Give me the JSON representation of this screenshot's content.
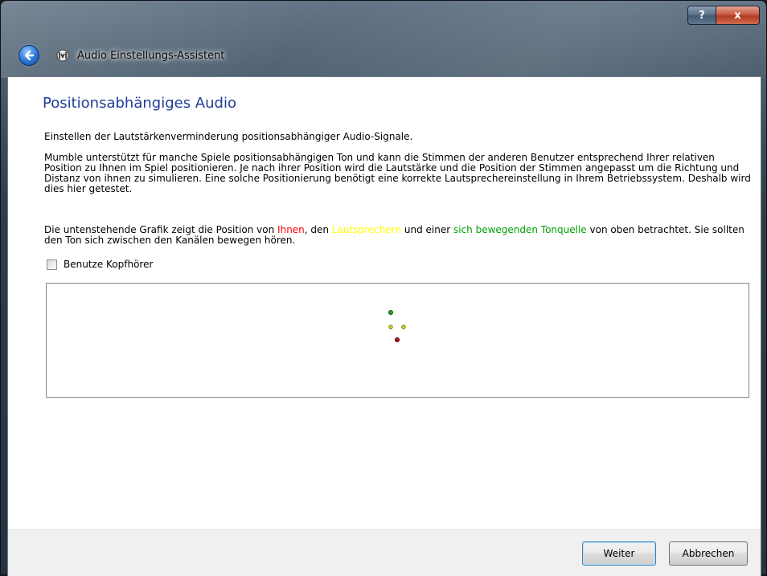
{
  "window": {
    "title": "Audio Einstellungs-Assistent",
    "help_label": "?",
    "close_label": "x"
  },
  "page": {
    "heading": "Positionsabhängiges Audio",
    "subtitle": "Einstellen der Lautstärkenverminderung positionsabhängiger Audio-Signale.",
    "description": "Mumble unterstützt für manche Spiele positionsabhängigen Ton und kann die Stimmen der anderen Benutzer entsprechend Ihrer relativen Position zu Ihnen im Spiel positionieren. Je nach ihrer Position wird die Lautstärke und die Position der Stimmen angepasst um die Richtung und Distanz von ihnen zu simulieren. Eine solche Positionierung benötigt eine korrekte Lautsprechereinstellung in Ihrem Betriebssystem. Deshalb wird dies hier getestet.",
    "graphic_intro_1": "Die untenstehende Grafik zeigt die Position von ",
    "you_word": "Ihnen",
    "sep_1": ", den ",
    "speakers_word": "Lautsprechern",
    "sep_2": " und einer ",
    "source_word": "sich bewegenden Tonquelle",
    "graphic_intro_2": " von oben betrachtet. Sie sollten den Ton sich zwischen den Kanälen bewegen hören.",
    "headphones_label": "Benutze Kopfhörer",
    "headphones_checked": false
  },
  "colors": {
    "you": "#ff0000",
    "speakers": "#ffff00",
    "source": "#00a000",
    "heading": "#1e3c9a"
  },
  "buttons": {
    "next": "Weiter",
    "cancel": "Abbrechen"
  }
}
